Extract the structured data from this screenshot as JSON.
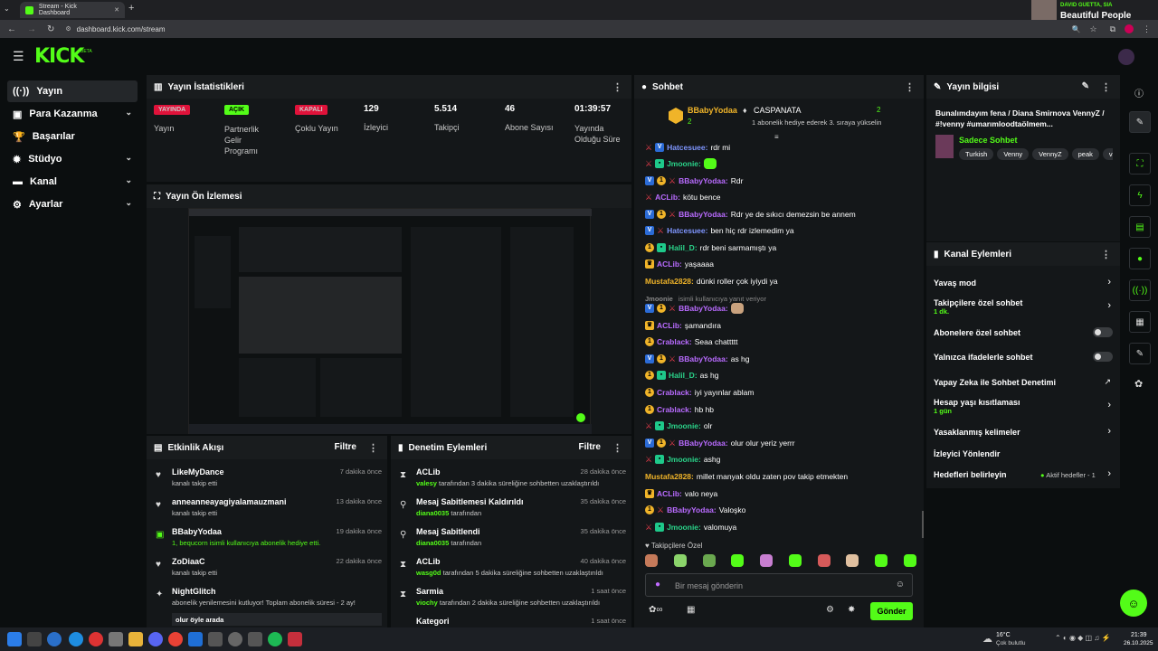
{
  "browser": {
    "tab_title": "Stream - Kick Dashboard",
    "url": "dashboard.kick.com/stream",
    "media_artist": "DAVID GUETTA, SIA",
    "media_title": "Beautiful People"
  },
  "brand": {
    "logo": "KICK",
    "beta": "BETA",
    "accent": "#53fc18"
  },
  "sidebar": {
    "items": [
      {
        "label": "Yayın",
        "icon": "broadcast-icon",
        "active": true
      },
      {
        "label": "Para Kazanma",
        "icon": "wallet-icon",
        "chevron": true
      },
      {
        "label": "Başarılar",
        "icon": "trophy-icon"
      },
      {
        "label": "Stüdyo",
        "icon": "gear-icon",
        "chevron": true
      },
      {
        "label": "Kanal",
        "icon": "chat-icon",
        "chevron": true
      },
      {
        "label": "Ayarlar",
        "icon": "settings-icon",
        "chevron": true
      }
    ]
  },
  "stats": {
    "title": "Yayın İstatistikleri",
    "items": [
      {
        "badge": "YAYINDA",
        "label": "Yayın",
        "color": "#e0123a"
      },
      {
        "badge": "AÇIK",
        "label": "Partnerlik Gelir Programı",
        "color": "#53fc18"
      },
      {
        "badge": "KAPALI",
        "label": "Çoklu Yayın",
        "color": "#e0123a"
      },
      {
        "value": "129",
        "label": "İzleyici"
      },
      {
        "value": "5.514",
        "label": "Takipçi"
      },
      {
        "value": "46",
        "label": "Abone Sayısı"
      },
      {
        "value": "01:39:57",
        "label": "Yayında Olduğu Süre"
      }
    ]
  },
  "preview": {
    "title": "Yayın Ön İzlemesi"
  },
  "activity": {
    "title": "Etkinlik Akışı",
    "filter": "Filtre",
    "items": [
      {
        "name": "LikeMyDance",
        "desc": "kanalı takip etti",
        "time": "7 dakika önce",
        "icon": "heart-icon"
      },
      {
        "name": "anneanneayagiyalamauzmani",
        "desc": "kanalı takip etti",
        "time": "13 dakika önce",
        "icon": "heart-icon"
      },
      {
        "name": "BBabyYodaa",
        "desc": "1, bequcorn isimli kullanıcıya abonelik hediye etti.",
        "time": "19 dakika önce",
        "icon": "gift-icon"
      },
      {
        "name": "ZoDiaaC",
        "desc": "kanalı takip etti",
        "time": "22 dakika önce",
        "icon": "heart-icon"
      },
      {
        "name": "NightGlitch",
        "desc": "abonelik yenilemesini kutluyor! Toplam abonelik süresi - 2 ay!",
        "time": "",
        "icon": "star-icon"
      }
    ],
    "last_note": "olur öyle arada"
  },
  "moderation": {
    "title": "Denetim Eylemleri",
    "filter": "Filtre",
    "items": [
      {
        "name": "ACLib",
        "actor": "valesy",
        "desc": "tarafından 3 dakika süreliğine sohbetten uzaklaştırıldı",
        "time": "28 dakika önce",
        "icon": "hourglass-icon"
      },
      {
        "name": "Mesaj Sabitlemesi Kaldırıldı",
        "actor": "diana0035",
        "desc": "tarafından",
        "time": "35 dakika önce",
        "icon": "unpin-icon"
      },
      {
        "name": "Mesaj Sabitlendi",
        "actor": "diana0035",
        "desc": "tarafından",
        "time": "35 dakika önce",
        "icon": "pin-icon"
      },
      {
        "name": "ACLib",
        "actor": "wasg0d",
        "desc": "tarafından 5 dakika süreliğine sohbetten uzaklaştırıldı",
        "time": "40 dakika önce",
        "icon": "hourglass-icon"
      },
      {
        "name": "Sarmia",
        "actor": "viochy",
        "desc": "tarafından 2 dakika süreliğine sohbetten uzaklaştırıldı",
        "time": "1 saat önce",
        "icon": "hourglass-icon"
      },
      {
        "name": "Kategori",
        "actor": "",
        "desc": "",
        "time": "1 saat önce",
        "icon": "hourglass-icon"
      }
    ]
  },
  "chat": {
    "title": "Sohbet",
    "pinned_user1": "BBabyYodaa",
    "pinned_count1": "2",
    "pinned_user2": "CASPANATA",
    "pinned_count2": "2",
    "pinned_note": "1 abonelik hediye ederek 3. sıraya yükselin",
    "messages": [
      {
        "user": "Hatcesuee",
        "text": "rdr mi",
        "color": "#7f96ff",
        "badges": [
          "mod",
          "vip"
        ]
      },
      {
        "user": "Jmoonie",
        "text": "",
        "color": "#2ad48a",
        "badges": [
          "mod",
          "og"
        ],
        "emote": true
      },
      {
        "user": "BBabyYodaa",
        "text": "Rdr",
        "color": "#b96bff",
        "badges": [
          "vip",
          "sub",
          "mod"
        ]
      },
      {
        "user": "ACLib",
        "text": "kötu bence",
        "color": "#b96bff",
        "badges": [
          "mod"
        ]
      },
      {
        "user": "BBabyYodaa",
        "text": "Rdr ye de sıkıcı demezsin be annem",
        "color": "#b96bff",
        "badges": [
          "vip",
          "sub",
          "mod"
        ]
      },
      {
        "user": "Hatcesuee",
        "text": "ben hiç rdr izlemedim ya",
        "color": "#7f96ff",
        "badges": [
          "vip",
          "mod"
        ]
      },
      {
        "user": "Halil_D",
        "text": "rdr beni sarmamıştı ya",
        "color": "#2ad48a",
        "badges": [
          "sub",
          "og"
        ]
      },
      {
        "user": "ACLib",
        "text": "yaşaaaa",
        "color": "#b96bff",
        "badges": [
          "crown"
        ]
      },
      {
        "user": "Mustafa2828",
        "text": "dünki roller çok iyiydi ya",
        "color": "#f0b429",
        "badges": []
      },
      {
        "user": "Jmoonie",
        "text": "isimli kullanıcıya yanıt veriyor",
        "color": "#888",
        "badges": [],
        "reply": true
      },
      {
        "user": "BBabyYodaa",
        "text": "",
        "color": "#b96bff",
        "badges": [
          "vip",
          "sub",
          "mod"
        ],
        "emote": true
      },
      {
        "user": "ACLib",
        "text": "şamandıra",
        "color": "#b96bff",
        "badges": [
          "crown"
        ]
      },
      {
        "user": "Crablack",
        "text": "Seaa chattttt",
        "color": "#b96bff",
        "badges": [
          "sub"
        ]
      },
      {
        "user": "BBabyYodaa",
        "text": "as hg",
        "color": "#b96bff",
        "badges": [
          "vip",
          "sub",
          "mod"
        ]
      },
      {
        "user": "Halil_D",
        "text": "as hg",
        "color": "#2ad48a",
        "badges": [
          "sub",
          "og"
        ]
      },
      {
        "user": "Crablack",
        "text": "iyi yayınlar ablam",
        "color": "#b96bff",
        "badges": [
          "sub"
        ]
      },
      {
        "user": "Crablack",
        "text": "hb hb",
        "color": "#b96bff",
        "badges": [
          "sub"
        ]
      },
      {
        "user": "Jmoonie",
        "text": "olr",
        "color": "#2ad48a",
        "badges": [
          "mod",
          "og"
        ]
      },
      {
        "user": "BBabyYodaa",
        "text": "olur olur yeriz yerrr",
        "color": "#b96bff",
        "badges": [
          "vip",
          "sub",
          "mod"
        ]
      },
      {
        "user": "Jmoonie",
        "text": "ashg",
        "color": "#2ad48a",
        "badges": [
          "mod",
          "og"
        ]
      },
      {
        "user": "Mustafa2828",
        "text": "millet manyak oldu zaten pov takip etmekten",
        "color": "#f0b429",
        "badges": []
      },
      {
        "user": "ACLib",
        "text": "valo neya",
        "color": "#b96bff",
        "badges": [
          "crown"
        ]
      },
      {
        "user": "BBabyYodaa",
        "text": "Valoşko",
        "color": "#b96bff",
        "badges": [
          "sub",
          "mod"
        ]
      },
      {
        "user": "Jmoonie",
        "text": "valomuya",
        "color": "#2ad48a",
        "badges": [
          "mod",
          "og"
        ]
      }
    ],
    "followers_only": "Takipçilere Özel",
    "input_placeholder": "Bir mesaj gönderin",
    "send": "Gönder"
  },
  "stream_info": {
    "title": "Yayın bilgisi",
    "stream_title": "Bunalımdayım fena / Diana Smirnova VennyZ / #!venny #umarımloodtaölmem...",
    "category": "Sadece Sohbet",
    "tags": [
      "Turkish",
      "Venny",
      "VennyZ",
      "peak",
      "va"
    ]
  },
  "channel_actions": {
    "title": "Kanal Eylemleri",
    "items": [
      {
        "label": "Yavaş mod",
        "sub": "",
        "kind": "chevron"
      },
      {
        "label": "Takipçilere özel sohbet",
        "sub": "1 dk.",
        "kind": "chevron"
      },
      {
        "label": "Abonelere özel sohbet",
        "sub": "",
        "kind": "toggle"
      },
      {
        "label": "Yalnızca ifadelerle sohbet",
        "sub": "",
        "kind": "toggle"
      },
      {
        "label": "Yapay Zeka ile Sohbet Denetimi",
        "sub": "",
        "kind": "external"
      },
      {
        "label": "Hesap yaşı kısıtlaması",
        "sub": "1 gün",
        "kind": "chevron"
      },
      {
        "label": "Yasaklanmış kelimeler",
        "sub": "",
        "kind": "chevron"
      },
      {
        "label": "İzleyici Yönlendir",
        "sub": "",
        "kind": "none"
      },
      {
        "label": "Hedefleri belirleyin",
        "sub": "",
        "kind": "chevron",
        "extra": "Aktif hedefler - 1"
      }
    ]
  },
  "taskbar": {
    "weather": "16°C",
    "weather_desc": "Çok bulutlu",
    "time": "21:39",
    "date": "26.10.2025"
  }
}
